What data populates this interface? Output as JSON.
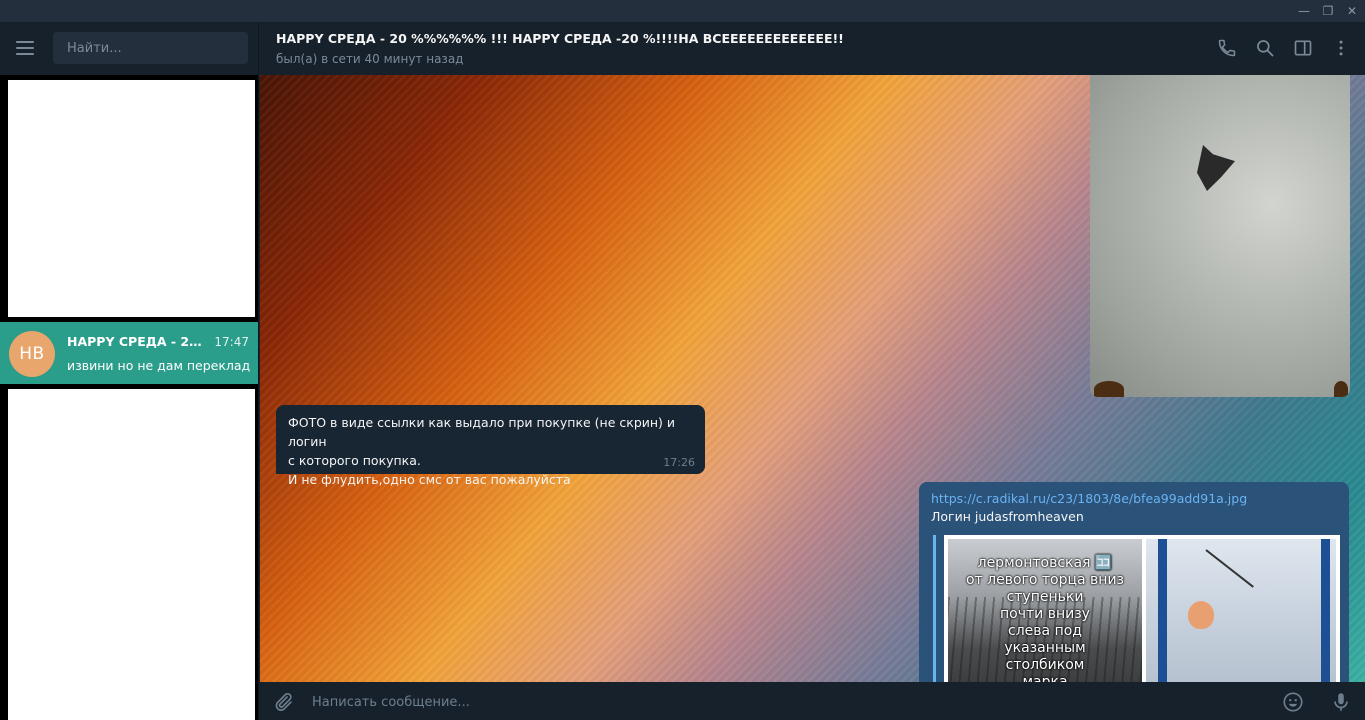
{
  "window": {
    "minimize_glyph": "—",
    "maximize_glyph": "❐",
    "close_glyph": "✕"
  },
  "sidebar": {
    "search_placeholder": "Найти...",
    "chats": [
      {
        "avatar_initials": "HB",
        "avatar_color": "#e8a56c",
        "name": "HAPPY СРЕДА - 20 %...",
        "time": "17:47",
        "preview": "извини но не дам переклад"
      }
    ]
  },
  "header": {
    "title": "HAPPY СРЕДА - 20 %%%%%% !!! HAPPY СРЕДА -20 %!!!!НА ВСЕЕЕЕЕЕЕЕЕЕЕЕЕ!!",
    "status": "был(а) в сети 40 минут назад",
    "icons": [
      "phone-icon",
      "search-icon",
      "sidebar-toggle-icon",
      "more-vertical-icon"
    ]
  },
  "messages": {
    "incoming": {
      "text": "ФОТО в виде  ссылки как выдало при покупке  (не скрин) и логин\nс которого покупка.\nИ не флудить,одно смс от вас пожалуйста",
      "time": "17:26"
    },
    "outgoing": {
      "link": "https://c.radikal.ru/c23/1803/8e/bfea99add91a.jpg",
      "text": "Логин judasfromheaven",
      "preview_caption": "лермонтовская 🈁\nот левого торца вниз\nступеньки\nпочти внизу\nслева под\nуказанным\nстолбиком\nмарка"
    }
  },
  "composer": {
    "placeholder": "Написать сообщение..."
  },
  "colors": {
    "accent": "#2b9d8b",
    "link": "#6ab3f3",
    "background": "#17212b"
  }
}
